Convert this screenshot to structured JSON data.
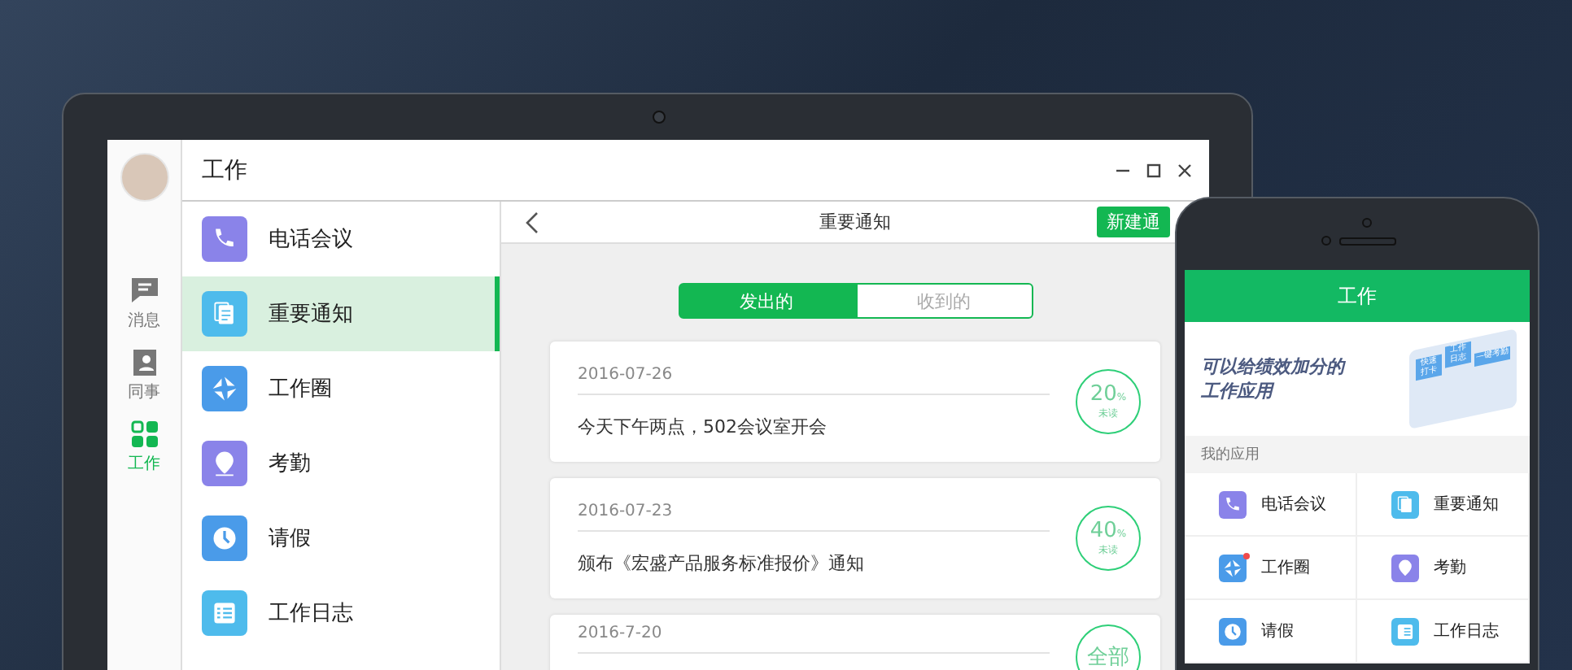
{
  "window": {
    "title": "工作"
  },
  "rail": [
    {
      "label": "消息",
      "kind": "chat",
      "selected": false
    },
    {
      "label": "同事",
      "kind": "contacts",
      "selected": false
    },
    {
      "label": "工作",
      "kind": "grid",
      "selected": true
    }
  ],
  "apps": [
    {
      "name": "电话会议",
      "kind": "phone",
      "color": "#8a83e9",
      "selected": false
    },
    {
      "name": "重要通知",
      "kind": "doc",
      "color": "#4ebbec",
      "selected": true
    },
    {
      "name": "工作圈",
      "kind": "pinwheel",
      "color": "#4a9be9",
      "selected": false
    },
    {
      "name": "考勤",
      "kind": "pin",
      "color": "#8a83e9",
      "selected": false
    },
    {
      "name": "请假",
      "kind": "clock",
      "color": "#4a9be9",
      "selected": false
    },
    {
      "name": "工作日志",
      "kind": "list",
      "color": "#4ebbec",
      "selected": false
    }
  ],
  "detail": {
    "title": "重要通知",
    "new_button": "新建通",
    "tabs": [
      {
        "label": "发出的",
        "selected": true
      },
      {
        "label": "收到的",
        "selected": false
      }
    ],
    "notices": [
      {
        "date": "2016-07-26",
        "text": "今天下午两点，502会议室开会",
        "ring": {
          "value": "20",
          "unit": "%",
          "label": "未读"
        }
      },
      {
        "date": "2016-07-23",
        "text": "颁布《宏盛产品服务标准报价》通知",
        "ring": {
          "value": "40",
          "unit": "%",
          "label": "未读"
        }
      },
      {
        "date": "2016-7-20",
        "ring": {
          "value": "全部"
        }
      }
    ]
  },
  "phone": {
    "title": "工作",
    "banner_lines": [
      "可以给绩效加分的",
      "工作应用"
    ],
    "banner_tags": [
      "快速打卡",
      "工作日志",
      "一键考勤"
    ],
    "section": "我的应用",
    "apps": [
      {
        "name": "电话会议",
        "kind": "phone",
        "color": "#8a83e9",
        "badge": false
      },
      {
        "name": "重要通知",
        "kind": "doc",
        "color": "#4ebbec",
        "badge": false
      },
      {
        "name": "工作圈",
        "kind": "pinwheel",
        "color": "#4a9be9",
        "badge": true
      },
      {
        "name": "考勤",
        "kind": "pin",
        "color": "#8a83e9",
        "badge": false
      },
      {
        "name": "请假",
        "kind": "clock",
        "color": "#4a9be9",
        "badge": false
      },
      {
        "name": "工作日志",
        "kind": "list",
        "color": "#4ebbec",
        "badge": false
      }
    ]
  }
}
